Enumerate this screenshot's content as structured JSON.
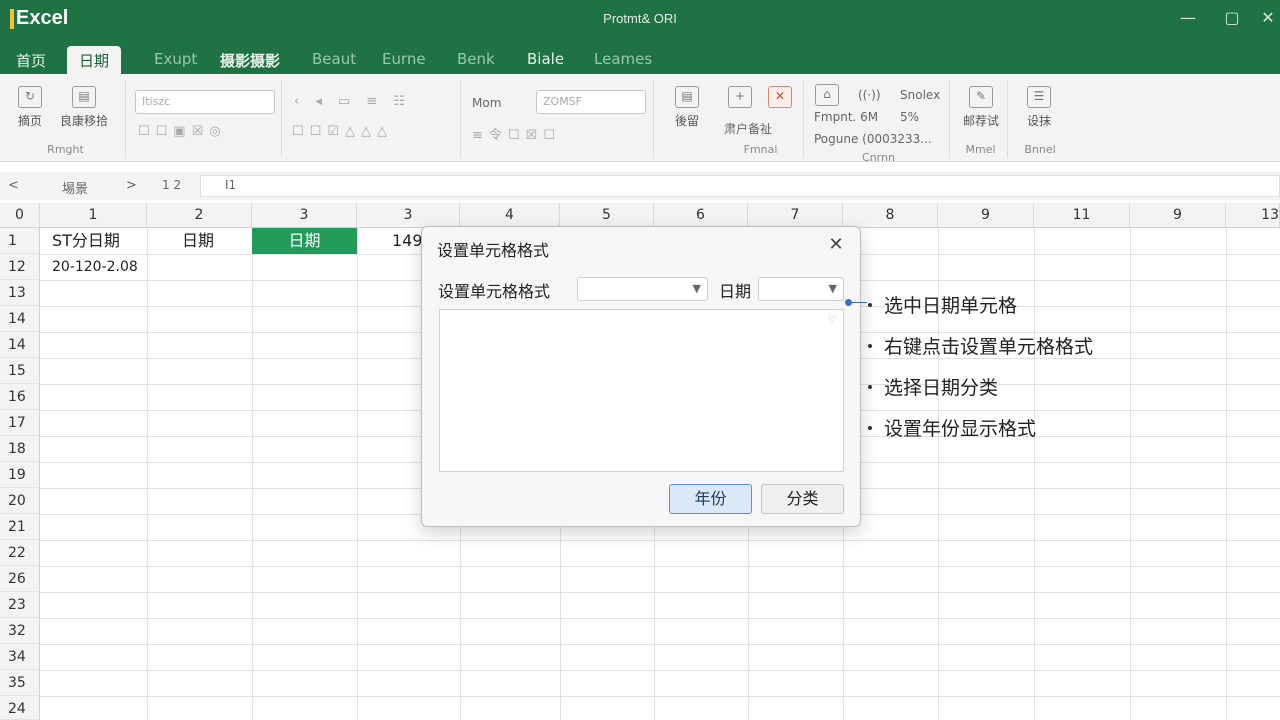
{
  "app": {
    "name": "Excel",
    "doc_title": "Protmt& ORI"
  },
  "window_controls": [
    "—",
    "▢",
    "✕"
  ],
  "tabs": [
    {
      "label": "首页"
    },
    {
      "label": "日期"
    },
    {
      "label": "Exupt"
    },
    {
      "label": "摄影摄影"
    },
    {
      "label": "Beaut"
    },
    {
      "label": "Eurne"
    },
    {
      "label": "Benk"
    },
    {
      "label": "Biale"
    },
    {
      "label": "Leames"
    }
  ],
  "ribbon": {
    "group1": {
      "btn1": "摘页",
      "btn2": "良康移拾",
      "caption": "Rmght"
    },
    "font_box": "Itiszc",
    "font_label": "Mom",
    "size_box": "ZOMSF",
    "btn_format": "後留",
    "btn_fill": "肃户备祉",
    "fill_caption": "Fmnal",
    "number_labels": [
      "Fmpnt. 6M",
      "5%",
      "Pogune (0003233..."
    ],
    "number_top": "Snolex",
    "number_caption": "Cnrnn",
    "btn_review": "邮荐试",
    "btn_design": "设抹",
    "review_caption": "Mmel",
    "design_caption": "Bnnel"
  },
  "formula_bar": {
    "nav_back": "<",
    "name_box": "埸景",
    "nav_fwd": ">",
    "ref": "1  2",
    "content": "I1"
  },
  "columns": [
    "0",
    "1",
    "2",
    "3",
    "3",
    "4",
    "5",
    "6",
    "7",
    "8",
    "9",
    "11",
    "9",
    "13"
  ],
  "rows": [
    "1",
    "12",
    "13",
    "14",
    "14",
    "15",
    "16",
    "17",
    "18",
    "19",
    "20",
    "21",
    "22",
    "26",
    "23",
    "32",
    "34",
    "35",
    "24"
  ],
  "cells": {
    "a1": "ST分日期",
    "b1": "日期",
    "c1": "日期",
    "d1": "149",
    "a2": "20-120-2.08"
  },
  "dialog": {
    "title": "设置单元格格式",
    "close": "✕",
    "field1_label": "设置单元格格式",
    "field2_label": "日期",
    "ok": "年份",
    "cancel": "分类"
  },
  "callouts": [
    "选中日期单元格",
    "右键点击设置单元格格式",
    "选择日期分类",
    "设置年份显示格式"
  ],
  "colors": {
    "brand": "#1f7244",
    "selected_cell": "#219a5a",
    "primary_button_border": "#5b8ed6"
  }
}
